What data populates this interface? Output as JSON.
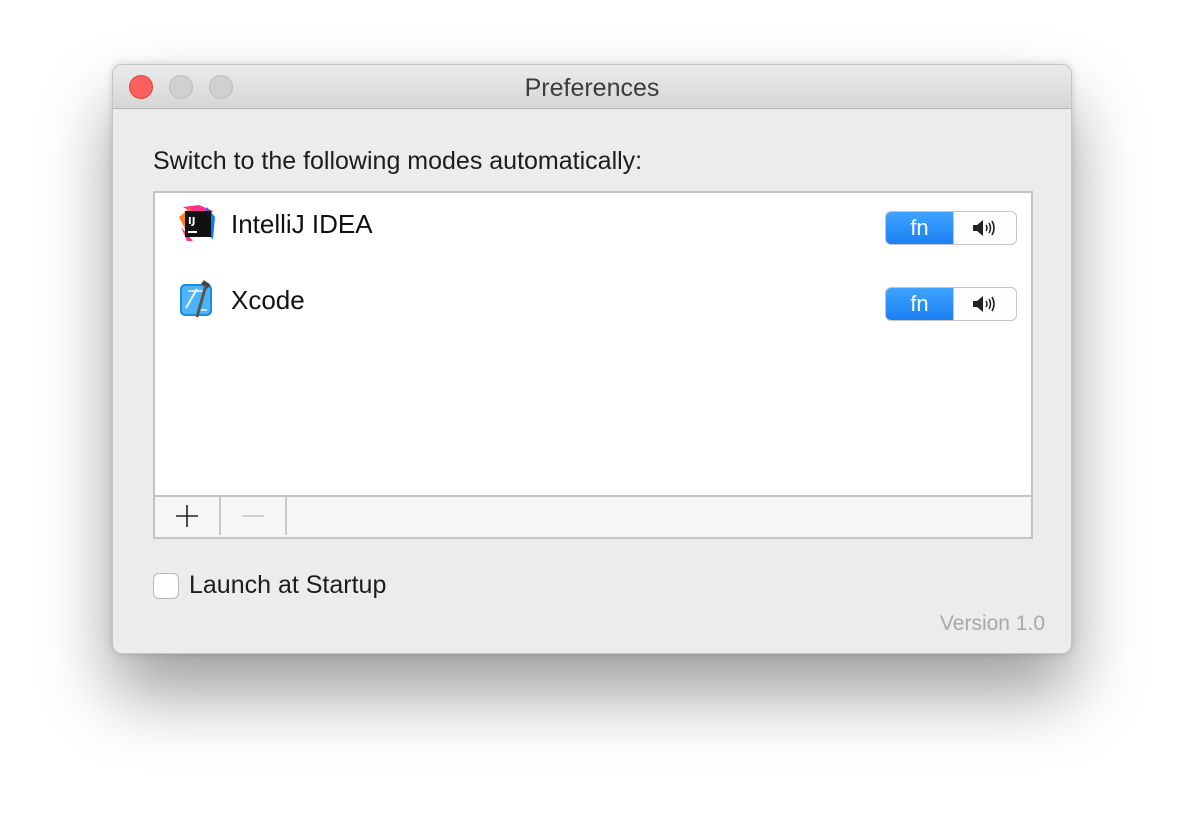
{
  "window": {
    "title": "Preferences"
  },
  "main": {
    "heading": "Switch to the following modes automatically:",
    "apps": [
      {
        "name": "IntelliJ IDEA",
        "icon": "intellij-idea-icon",
        "mode_options": [
          "fn",
          "speaker-icon"
        ],
        "selected_mode": "fn"
      },
      {
        "name": "Xcode",
        "icon": "xcode-icon",
        "mode_options": [
          "fn",
          "speaker-icon"
        ],
        "selected_mode": "fn"
      }
    ],
    "toolbar": {
      "add_icon": "plus-icon",
      "remove_icon": "minus-icon"
    }
  },
  "footer": {
    "launch_label": "Launch at Startup",
    "launch_checked": false,
    "version": "Version 1.0"
  },
  "colors": {
    "accent": "#1b7ff3",
    "close": "#fc605c"
  }
}
